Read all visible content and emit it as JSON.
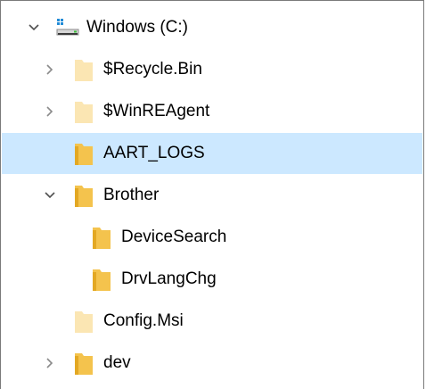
{
  "colors": {
    "selection": "#cce8ff",
    "folder": "#f4c34d",
    "folder_dark": "#e3a823",
    "folder_faded": "#fbe6b3",
    "chevron": "#505050",
    "drive_blue": "#1f8ad6"
  },
  "tree": {
    "items": [
      {
        "label": "Windows (C:)",
        "icon": "drive-icon",
        "expander": "expanded"
      },
      {
        "label": "$Recycle.Bin",
        "icon": "folder-hidden-icon",
        "expander": "collapsed"
      },
      {
        "label": "$WinREAgent",
        "icon": "folder-hidden-icon",
        "expander": "collapsed"
      },
      {
        "label": "AART_LOGS",
        "icon": "folder-icon",
        "expander": "none",
        "selected": true
      },
      {
        "label": "Brother",
        "icon": "folder-icon",
        "expander": "expanded"
      },
      {
        "label": "DeviceSearch",
        "icon": "folder-icon",
        "expander": "none"
      },
      {
        "label": "DrvLangChg",
        "icon": "folder-icon",
        "expander": "none"
      },
      {
        "label": "Config.Msi",
        "icon": "folder-hidden-icon",
        "expander": "none"
      },
      {
        "label": "dev",
        "icon": "folder-icon",
        "expander": "collapsed"
      }
    ]
  }
}
